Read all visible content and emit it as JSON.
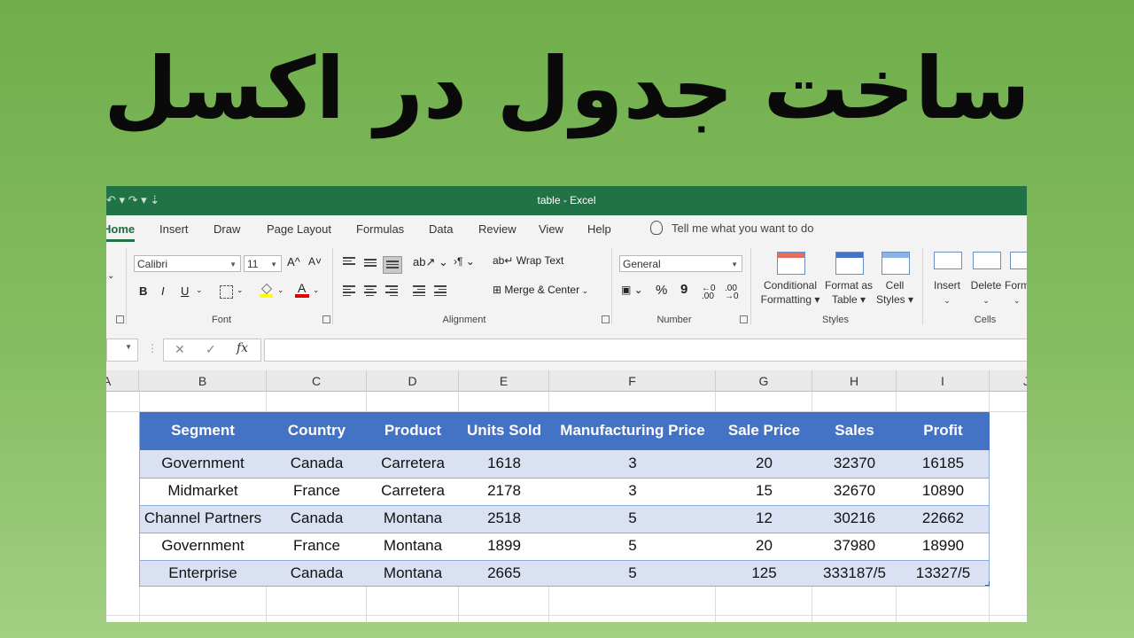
{
  "headline": "ساخت جدول در اکسل",
  "window": {
    "title": "table  -  Excel",
    "qat_glyphs": "↶ ▾  ↷ ▾  ⇣"
  },
  "tabs": [
    "Home",
    "Insert",
    "Draw",
    "Page Layout",
    "Formulas",
    "Data",
    "Review",
    "View",
    "Help"
  ],
  "tell_me": "Tell me what you want to do",
  "ribbon": {
    "font": {
      "name": "Calibri",
      "size": "11",
      "group_label": "Font",
      "bold": "B",
      "italic": "I",
      "underline": "U",
      "grow": "A^",
      "shrink": "A˅",
      "font_color": "A"
    },
    "alignment": {
      "wrap_text": "Wrap Text",
      "merge_center": "Merge & Center",
      "group_label": "Alignment"
    },
    "number": {
      "format": "General",
      "group_label": "Number",
      "percent": "%",
      "comma": "9",
      "inc_dec": "←0 .00",
      "dec_dec": ".00 →0"
    },
    "styles": {
      "conditional_formatting": [
        "Conditional",
        "Formatting ▾"
      ],
      "format_as_table": [
        "Format as",
        "Table ▾"
      ],
      "cell_styles": [
        "Cell",
        "Styles ▾"
      ],
      "group_label": "Styles"
    },
    "cells": {
      "insert": "Insert",
      "delete": "Delete",
      "format": "Form",
      "group_label": "Cells"
    }
  },
  "formula_bar": {
    "fx": "fx",
    "cancel": "✕",
    "enter": "✓"
  },
  "columns": [
    "A",
    "B",
    "C",
    "D",
    "E",
    "F",
    "G",
    "H",
    "I",
    "J"
  ],
  "table": {
    "headers": [
      "Segment",
      "Country",
      "Product",
      "Units Sold",
      "Manufacturing Price",
      "Sale Price",
      "Sales",
      "Profit"
    ],
    "rows": [
      [
        "Government",
        "Canada",
        "Carretera",
        "1618",
        "3",
        "20",
        "32370",
        "16185"
      ],
      [
        "Midmarket",
        "France",
        "Carretera",
        "2178",
        "3",
        "15",
        "32670",
        "10890"
      ],
      [
        "Channel Partners",
        "Canada",
        "Montana",
        "2518",
        "5",
        "12",
        "30216",
        "22662"
      ],
      [
        "Government",
        "France",
        "Montana",
        "1899",
        "5",
        "20",
        "37980",
        "18990"
      ],
      [
        "Enterprise",
        "Canada",
        "Montana",
        "2665",
        "5",
        "125",
        "333187/5",
        "13327/5"
      ]
    ]
  },
  "colors": {
    "excel_green": "#217346",
    "table_header": "#4472c4",
    "band": "#d9e1f2",
    "background": "#7ab556"
  }
}
